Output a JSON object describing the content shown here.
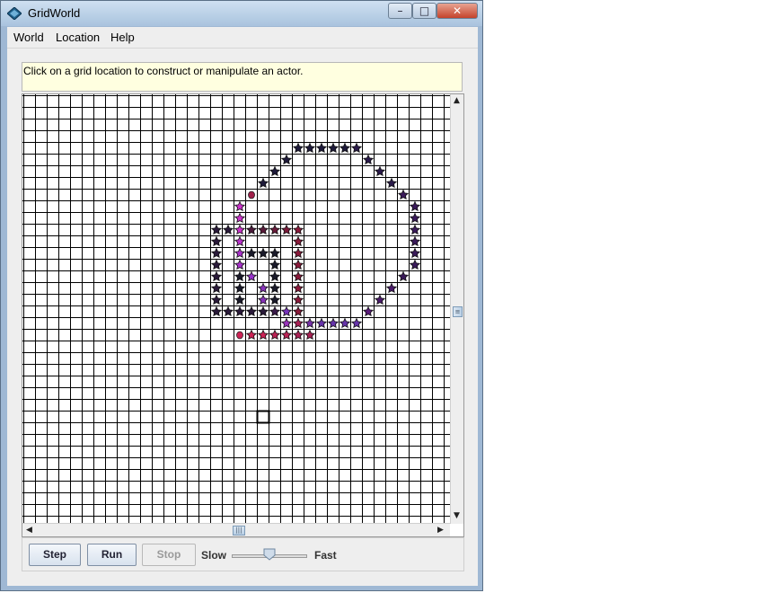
{
  "window": {
    "title": "GridWorld",
    "controls": {
      "minimize": "–",
      "maximize": "□",
      "close": "✕"
    }
  },
  "menu": {
    "items": [
      "World",
      "Location",
      "Help"
    ]
  },
  "message": "Click on a grid location to construct or manipulate an actor.",
  "grid": {
    "cols": 36,
    "rows": 36,
    "selected": [
      27,
      20
    ],
    "actors": [
      {
        "r": 4,
        "c": 23,
        "color": "#1e1a3a"
      },
      {
        "r": 4,
        "c": 24,
        "color": "#1e1a3a"
      },
      {
        "r": 4,
        "c": 25,
        "color": "#1e1a3a"
      },
      {
        "r": 4,
        "c": 26,
        "color": "#1e1a3a"
      },
      {
        "r": 4,
        "c": 27,
        "color": "#1e1a3a"
      },
      {
        "r": 4,
        "c": 28,
        "color": "#2a1a4a"
      },
      {
        "r": 5,
        "c": 22,
        "color": "#1e1a3a"
      },
      {
        "r": 5,
        "c": 29,
        "color": "#2a1a4a"
      },
      {
        "r": 6,
        "c": 21,
        "color": "#1e1a3a"
      },
      {
        "r": 6,
        "c": 30,
        "color": "#2a1a4a"
      },
      {
        "r": 7,
        "c": 20,
        "color": "#1e1a3a"
      },
      {
        "r": 7,
        "c": 31,
        "color": "#2a1a4a"
      },
      {
        "r": 8,
        "c": 19,
        "color": "#a0204a",
        "cat": true
      },
      {
        "r": 8,
        "c": 32,
        "color": "#3a1a5a"
      },
      {
        "r": 9,
        "c": 18,
        "color": "#cc33cc"
      },
      {
        "r": 9,
        "c": 33,
        "color": "#3a1a5a"
      },
      {
        "r": 10,
        "c": 18,
        "color": "#cc33cc"
      },
      {
        "r": 10,
        "c": 33,
        "color": "#3a1a5a"
      },
      {
        "r": 11,
        "c": 16,
        "color": "#2a1a3a"
      },
      {
        "r": 11,
        "c": 17,
        "color": "#2a1a3a"
      },
      {
        "r": 11,
        "c": 18,
        "color": "#cc33cc"
      },
      {
        "r": 11,
        "c": 19,
        "color": "#4a1a3a"
      },
      {
        "r": 11,
        "c": 20,
        "color": "#5a1a3a"
      },
      {
        "r": 11,
        "c": 21,
        "color": "#6a1a3a"
      },
      {
        "r": 11,
        "c": 22,
        "color": "#7a1a3a"
      },
      {
        "r": 11,
        "c": 23,
        "color": "#8a1a3a"
      },
      {
        "r": 11,
        "c": 33,
        "color": "#3a1a5a"
      },
      {
        "r": 12,
        "c": 16,
        "color": "#2a1a3a"
      },
      {
        "r": 12,
        "c": 18,
        "color": "#bb33cc"
      },
      {
        "r": 12,
        "c": 23,
        "color": "#8a1a3a"
      },
      {
        "r": 12,
        "c": 33,
        "color": "#3a1a5a"
      },
      {
        "r": 13,
        "c": 16,
        "color": "#2a1a3a"
      },
      {
        "r": 13,
        "c": 18,
        "color": "#aa33cc"
      },
      {
        "r": 13,
        "c": 19,
        "color": "#1a1a2a"
      },
      {
        "r": 13,
        "c": 20,
        "color": "#1a1a2a"
      },
      {
        "r": 13,
        "c": 21,
        "color": "#1a1a2a"
      },
      {
        "r": 13,
        "c": 23,
        "color": "#8a1a3a"
      },
      {
        "r": 13,
        "c": 33,
        "color": "#3a1a5a"
      },
      {
        "r": 14,
        "c": 16,
        "color": "#2a1a3a"
      },
      {
        "r": 14,
        "c": 18,
        "color": "#aa33cc"
      },
      {
        "r": 14,
        "c": 21,
        "color": "#1a1a2a"
      },
      {
        "r": 14,
        "c": 23,
        "color": "#8a1a3a"
      },
      {
        "r": 14,
        "c": 33,
        "color": "#3a1a5a"
      },
      {
        "r": 15,
        "c": 16,
        "color": "#2a1a3a"
      },
      {
        "r": 15,
        "c": 18,
        "color": "#1a1a2a"
      },
      {
        "r": 15,
        "c": 19,
        "color": "#9933cc"
      },
      {
        "r": 15,
        "c": 21,
        "color": "#1a1a2a"
      },
      {
        "r": 15,
        "c": 23,
        "color": "#8a1a3a"
      },
      {
        "r": 15,
        "c": 32,
        "color": "#3a1a5a"
      },
      {
        "r": 16,
        "c": 16,
        "color": "#2a1a3a"
      },
      {
        "r": 16,
        "c": 18,
        "color": "#1a1a2a"
      },
      {
        "r": 16,
        "c": 20,
        "color": "#8833bb"
      },
      {
        "r": 16,
        "c": 21,
        "color": "#1a1a2a"
      },
      {
        "r": 16,
        "c": 23,
        "color": "#8a1a3a"
      },
      {
        "r": 16,
        "c": 31,
        "color": "#4a1a6a"
      },
      {
        "r": 17,
        "c": 16,
        "color": "#2a1a3a"
      },
      {
        "r": 17,
        "c": 18,
        "color": "#1a1a2a"
      },
      {
        "r": 17,
        "c": 20,
        "color": "#8833bb"
      },
      {
        "r": 17,
        "c": 21,
        "color": "#1a1a2a"
      },
      {
        "r": 17,
        "c": 23,
        "color": "#8a1a3a"
      },
      {
        "r": 17,
        "c": 30,
        "color": "#4a1a6a"
      },
      {
        "r": 18,
        "c": 16,
        "color": "#2a1a3a"
      },
      {
        "r": 18,
        "c": 17,
        "color": "#2a1a3a"
      },
      {
        "r": 18,
        "c": 18,
        "color": "#2a1a3a"
      },
      {
        "r": 18,
        "c": 19,
        "color": "#2a1a3a"
      },
      {
        "r": 18,
        "c": 20,
        "color": "#2a1a3a"
      },
      {
        "r": 18,
        "c": 21,
        "color": "#3a1a4a"
      },
      {
        "r": 18,
        "c": 22,
        "color": "#7733bb"
      },
      {
        "r": 18,
        "c": 23,
        "color": "#8a1a3a"
      },
      {
        "r": 18,
        "c": 29,
        "color": "#5a1a7a"
      },
      {
        "r": 19,
        "c": 22,
        "color": "#9933bb"
      },
      {
        "r": 19,
        "c": 23,
        "color": "#aa2255"
      },
      {
        "r": 19,
        "c": 24,
        "color": "#7733aa"
      },
      {
        "r": 19,
        "c": 25,
        "color": "#6633aa"
      },
      {
        "r": 19,
        "c": 26,
        "color": "#6633aa"
      },
      {
        "r": 19,
        "c": 27,
        "color": "#6633aa"
      },
      {
        "r": 19,
        "c": 28,
        "color": "#6633aa"
      },
      {
        "r": 20,
        "c": 18,
        "color": "#cc2255",
        "cat": true
      },
      {
        "r": 20,
        "c": 19,
        "color": "#cc2255"
      },
      {
        "r": 20,
        "c": 20,
        "color": "#cc2255"
      },
      {
        "r": 20,
        "c": 21,
        "color": "#bb2255"
      },
      {
        "r": 20,
        "c": 22,
        "color": "#bb2255"
      },
      {
        "r": 20,
        "c": 23,
        "color": "#aa2255"
      },
      {
        "r": 20,
        "c": 24,
        "color": "#aa2255"
      }
    ]
  },
  "controls": {
    "step": "Step",
    "run": "Run",
    "stop": "Stop",
    "slow": "Slow",
    "fast": "Fast",
    "speed": 0.5
  }
}
